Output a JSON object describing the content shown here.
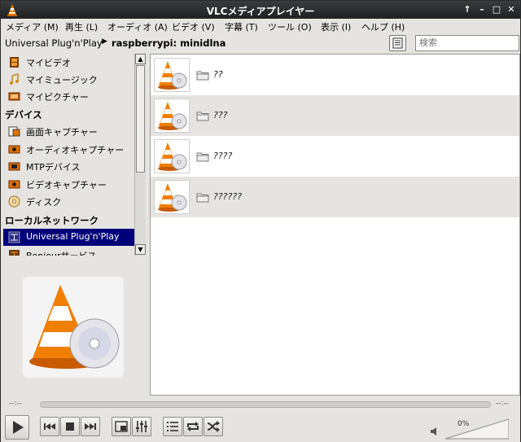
{
  "window": {
    "title": "VLCメディアプレイヤー"
  },
  "menu": [
    "メディア (M)",
    "再生 (L)",
    "オーディオ (A)",
    "ビデオ (V)",
    "字幕 (T)",
    "ツール (O)",
    "表示 (I)",
    "ヘルプ (H)"
  ],
  "path": {
    "root": "Universal Plug'n'Play",
    "current": "raspberrypi: minidlna"
  },
  "search": {
    "placeholder": "検索"
  },
  "sidebar": {
    "items_top": [
      {
        "label": "マイビデオ",
        "icon": "film-icon"
      },
      {
        "label": "マイミュージック",
        "icon": "music-note-icon"
      },
      {
        "label": "マイピクチャー",
        "icon": "picture-icon"
      }
    ],
    "devices_heading": "デバイス",
    "devices": [
      {
        "label": "画面キャプチャー",
        "icon": "screen-capture-icon"
      },
      {
        "label": "オーディオキャプチャー",
        "icon": "audio-capture-icon"
      },
      {
        "label": "MTPデバイス",
        "icon": "mtp-device-icon"
      },
      {
        "label": "ビデオキャプチャー",
        "icon": "video-capture-icon"
      },
      {
        "label": "ディスク",
        "icon": "disc-icon"
      }
    ],
    "lan_heading": "ローカルネットワーク",
    "lan": [
      {
        "label": "Universal Plug'n'Play",
        "icon": "network-icon",
        "selected": true
      },
      {
        "label": "Bonjourサービス",
        "icon": "bonjour-icon"
      }
    ]
  },
  "content": {
    "rows": [
      {
        "name": "??"
      },
      {
        "name": "???"
      },
      {
        "name": "????"
      },
      {
        "name": "??????"
      }
    ]
  },
  "player": {
    "time_elapsed": "--:--",
    "time_total": "--:--",
    "volume": "0%"
  },
  "colors": {
    "selection": "#00007a",
    "accent_orange": "#f07f00"
  }
}
